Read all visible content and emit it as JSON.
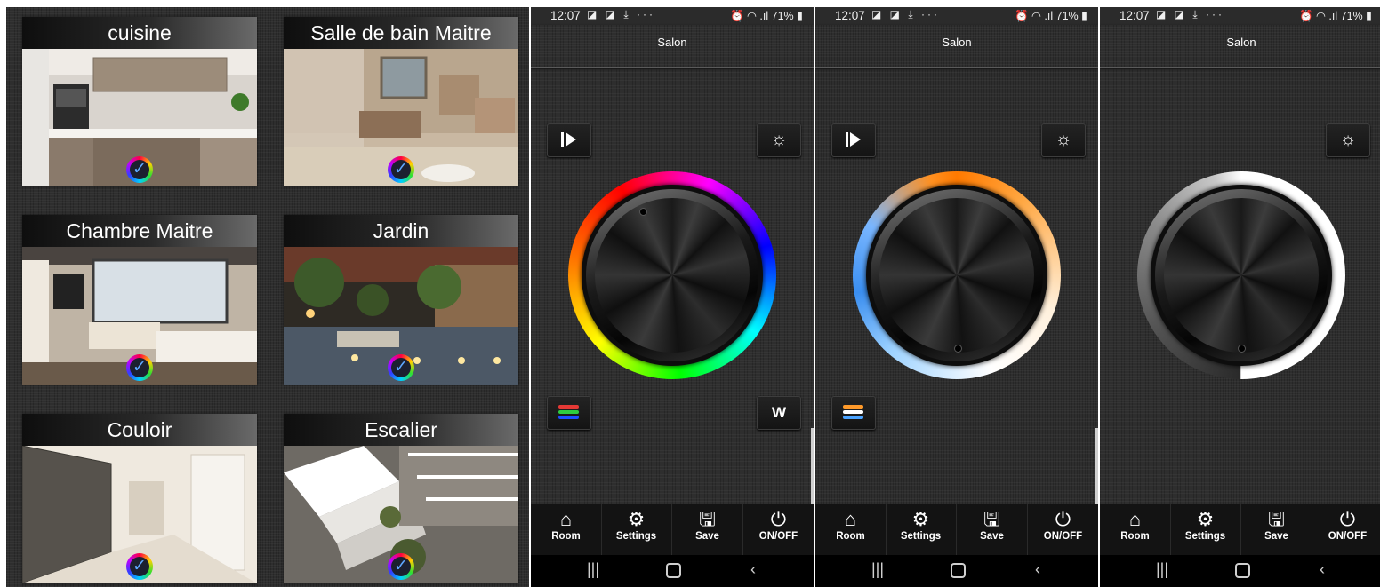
{
  "rooms": [
    {
      "name": "cuisine",
      "scene": "kitchen"
    },
    {
      "name": "Salle de bain Maitre",
      "scene": "bathroom"
    },
    {
      "name": "Chambre Maitre",
      "scene": "bedroom"
    },
    {
      "name": "Jardin",
      "scene": "garden"
    },
    {
      "name": "Couloir",
      "scene": "hallway"
    },
    {
      "name": "Escalier",
      "scene": "staircase"
    }
  ],
  "room_badge_icon": "checkmark-color-wheel-icon",
  "phones": [
    {
      "status": {
        "time": "12:07",
        "left_icons": "◪ ◪ ⤓ ···",
        "right": "⏰ ◠ .ıl 71% ▮"
      },
      "header_title": "Salon",
      "play_button": true,
      "brightness_icon": "☼",
      "mode_icon": "rgb-stripes-icon",
      "w_label": "W",
      "wheel": "rgb"
    },
    {
      "status": {
        "time": "12:07",
        "left_icons": "◪ ◪ ⤓ ···",
        "right": "⏰ ◠ .ıl 71% ▮"
      },
      "header_title": "Salon",
      "play_button": true,
      "brightness_icon": "☼",
      "mode_icon": "cct-stripes-icon",
      "wheel": "cct"
    },
    {
      "status": {
        "time": "12:07",
        "left_icons": "◪ ◪ ⤓ ···",
        "right": "⏰ ◠ .ıl 71% ▮"
      },
      "header_title": "Salon",
      "play_button": false,
      "brightness_icon": "☼",
      "wheel": "dim"
    }
  ],
  "nav": {
    "room": {
      "label": "Room",
      "icon": "⌂"
    },
    "settings": {
      "label": "Settings",
      "icon": "⚙"
    },
    "save": {
      "label": "Save",
      "icon": "🖫"
    },
    "onoff": {
      "label": "ON/OFF",
      "icon": "⏻"
    }
  },
  "system_nav": {
    "recents": "|||",
    "back": "‹"
  },
  "colors": {
    "rgb_stripes": [
      "#e53935",
      "#2ecc40",
      "#1e4dff"
    ],
    "cct_stripes": [
      "#ff9a2a",
      "#ffffff",
      "#4aa3ff"
    ]
  }
}
